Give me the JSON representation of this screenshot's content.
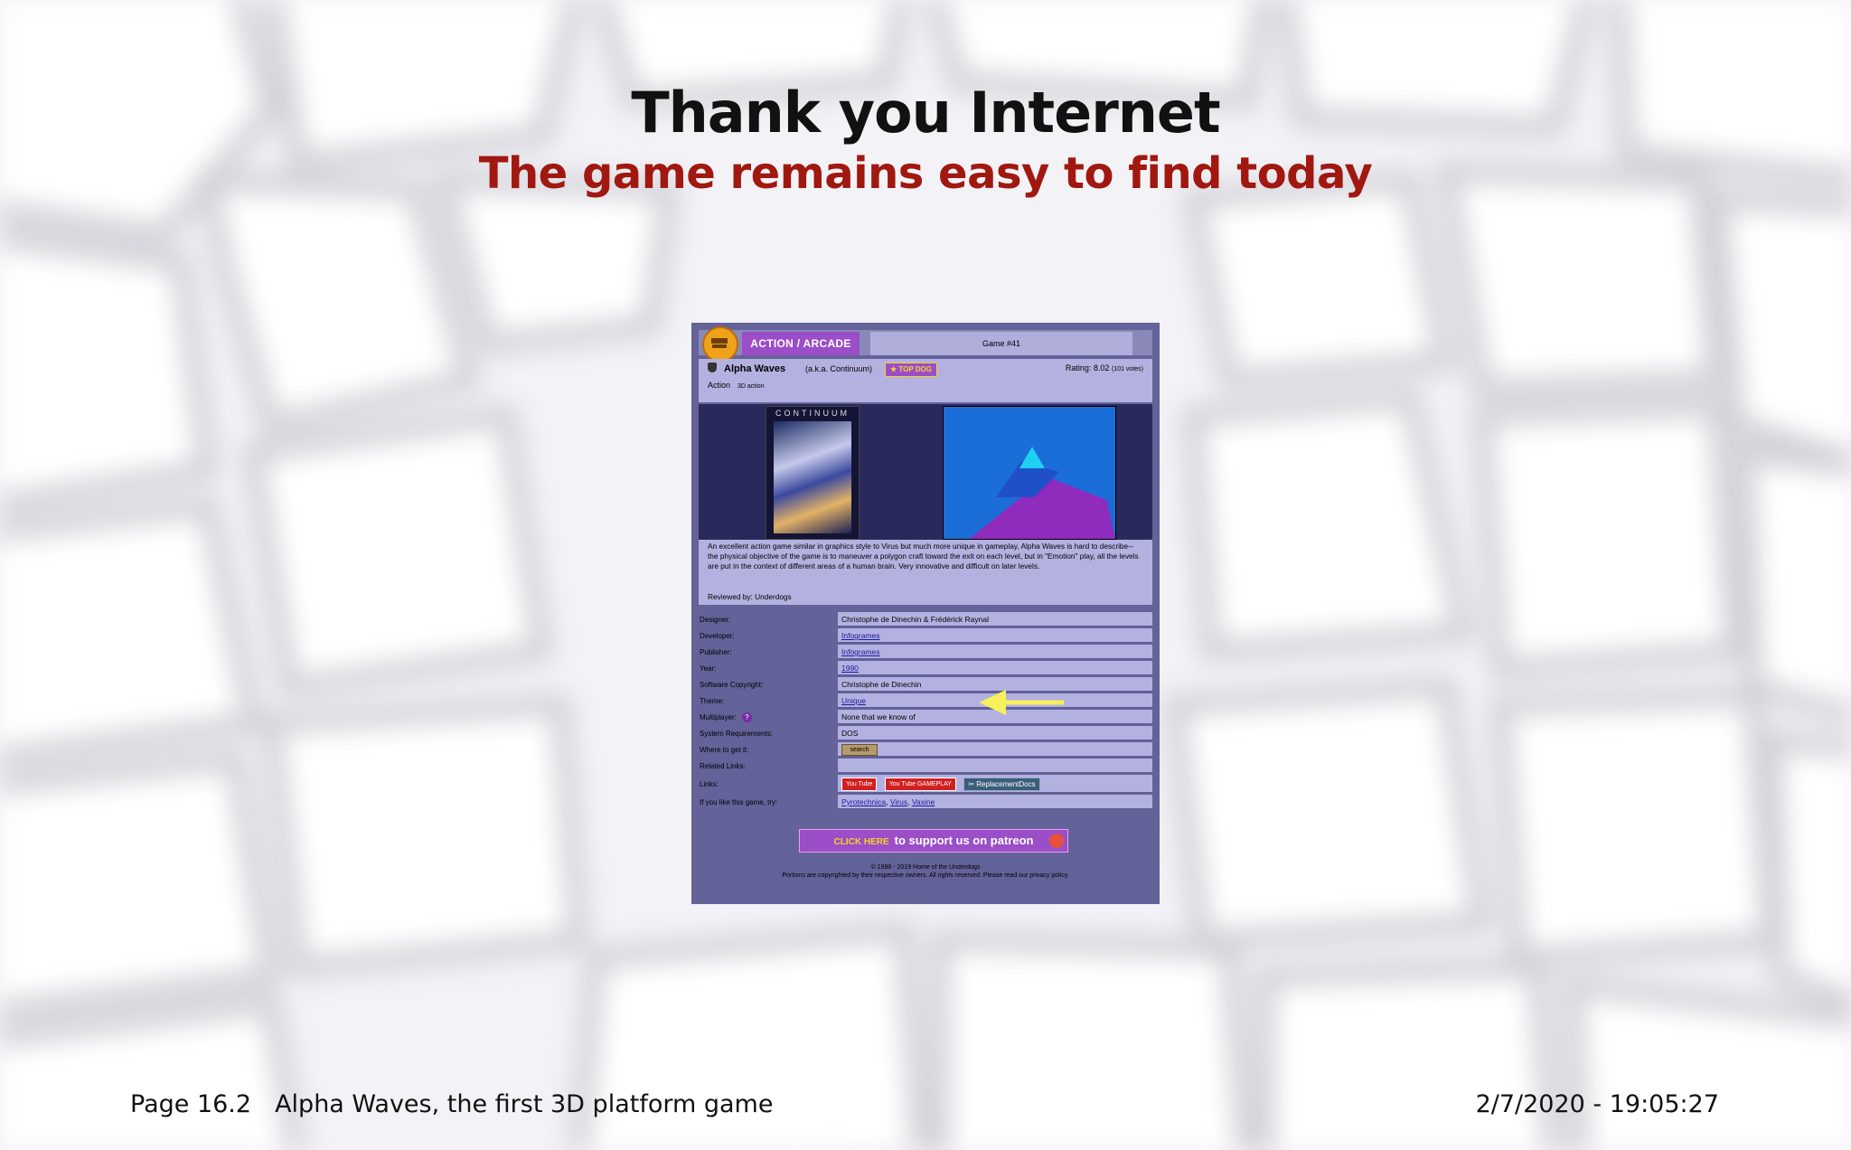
{
  "slide": {
    "title": "Thank you Internet",
    "subtitle": "The game remains easy to find today",
    "footer": {
      "page": "Page 16.2",
      "caption": "Alpha Waves, the first 3D platform game",
      "timestamp": "2/7/2020 - 19:05:27"
    }
  },
  "screenshot": {
    "category_tab": "ACTION / ARCADE",
    "game_number": "Game #41",
    "game_name": "Alpha Waves",
    "aka_label": "(a.k.a. Continuum)",
    "badge": "★ TOP DOG",
    "genre": "Action",
    "subgenre": "3D action",
    "rating": "Rating: 8.02",
    "votes": "(101 votes)",
    "box_logo": "CONTINUUM",
    "description": "An excellent action game similar in graphics style to Virus but much more unique in gameplay, Alpha Waves is hard to describe-- the physical objective of the game is to maneuver a polygon craft toward the exit on each level, but in \"Emotion\" play, all the levels are put in the context of different areas of a human brain. Very innovative and difficult on later levels.",
    "reviewed_by": "Reviewed by: Underdogs",
    "rows": [
      {
        "key": "Designer:",
        "value": "Christophe de Dinechin & Frédérick Raynal"
      },
      {
        "key": "Developer:",
        "value": "Infogrames"
      },
      {
        "key": "Publisher:",
        "value": "Infogrames"
      },
      {
        "key": "Year:",
        "value": "1990"
      },
      {
        "key": "Software Copyright:",
        "value": "Christophe de Dinechin"
      },
      {
        "key": "Theme:",
        "value": "Unique"
      },
      {
        "key": "Multiplayer:",
        "value": "None that we know of"
      },
      {
        "key": "System Requirements:",
        "value": "DOS"
      },
      {
        "key": "Where to get it:",
        "value": "search"
      },
      {
        "key": "Related Links:",
        "value": ""
      },
      {
        "key": "Links:",
        "value": ""
      },
      {
        "key": "If you like this game, try:",
        "value": ""
      }
    ],
    "links": {
      "youtube1": "You Tube",
      "youtube2": "You Tube GAMEPLAY",
      "replacement_docs": "✂ ReplacementDocs"
    },
    "try_games": [
      "Pyrotechnica",
      "Virus",
      "Vaxine"
    ],
    "patreon_click": "CLICK HERE",
    "patreon_text": "to support us on patreon",
    "copyright_1": "© 1998 - 2019 Home of the Underdogs",
    "copyright_2": "Portions are copyrighted by their respective owners. All rights reserved. Please read our privacy policy."
  },
  "colors": {
    "title": "#111111",
    "subtitle": "#a01810",
    "panel": "#636299",
    "accent_purple": "#9b4ec7",
    "arrow": "#f6f05a"
  }
}
